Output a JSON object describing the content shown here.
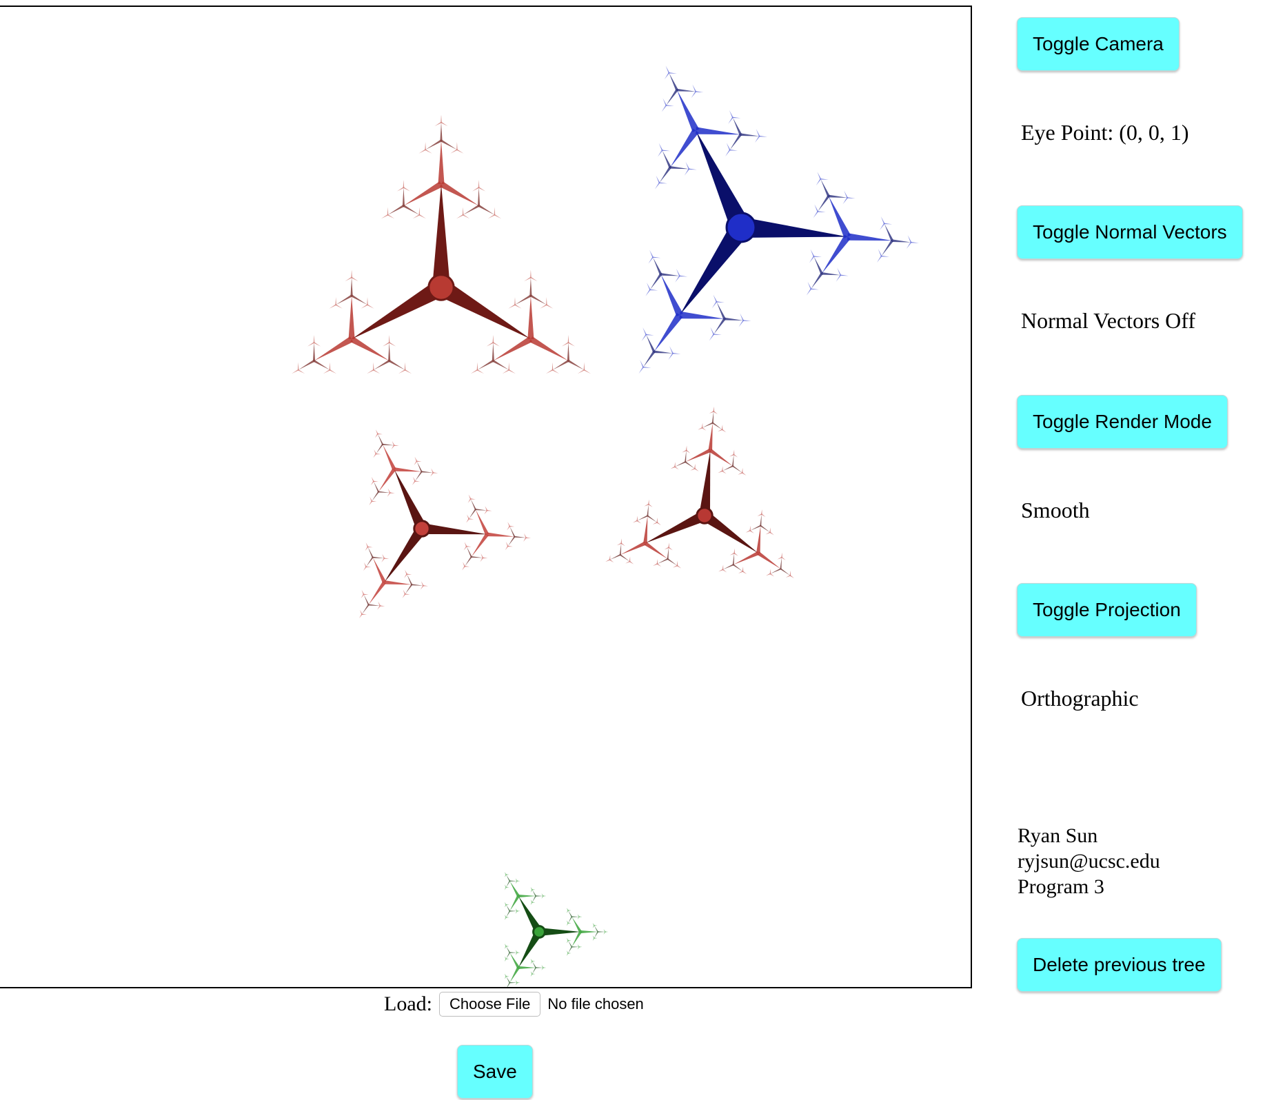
{
  "canvas": {
    "trees": [
      {
        "color": "#b83a32",
        "shade": "#6e1a16"
      },
      {
        "color": "#1f2ec8",
        "shade": "#0a0f6a"
      },
      {
        "color": "#c2403a",
        "shade": "#5a1512"
      },
      {
        "color": "#b83833",
        "shade": "#5a1512"
      },
      {
        "color": "#3aa33a",
        "shade": "#154d15"
      }
    ]
  },
  "controls": {
    "toggle_camera": "Toggle Camera",
    "eye_point": "Eye Point: (0, 0, 1)",
    "toggle_normals": "Toggle Normal Vectors",
    "normals_status": "Normal Vectors Off",
    "toggle_render": "Toggle Render Mode",
    "render_status": "Smooth",
    "toggle_projection": "Toggle Projection",
    "projection_status": "Orthographic",
    "delete_tree": "Delete previous tree"
  },
  "credits": {
    "name": "Ryan Sun",
    "email": "ryjsun@ucsc.edu",
    "program": "Program 3"
  },
  "load": {
    "label": "Load:",
    "choose_file": "Choose File",
    "file_status": "No file chosen"
  },
  "save_label": "Save",
  "colors": {
    "button_bg": "#66ffff"
  }
}
